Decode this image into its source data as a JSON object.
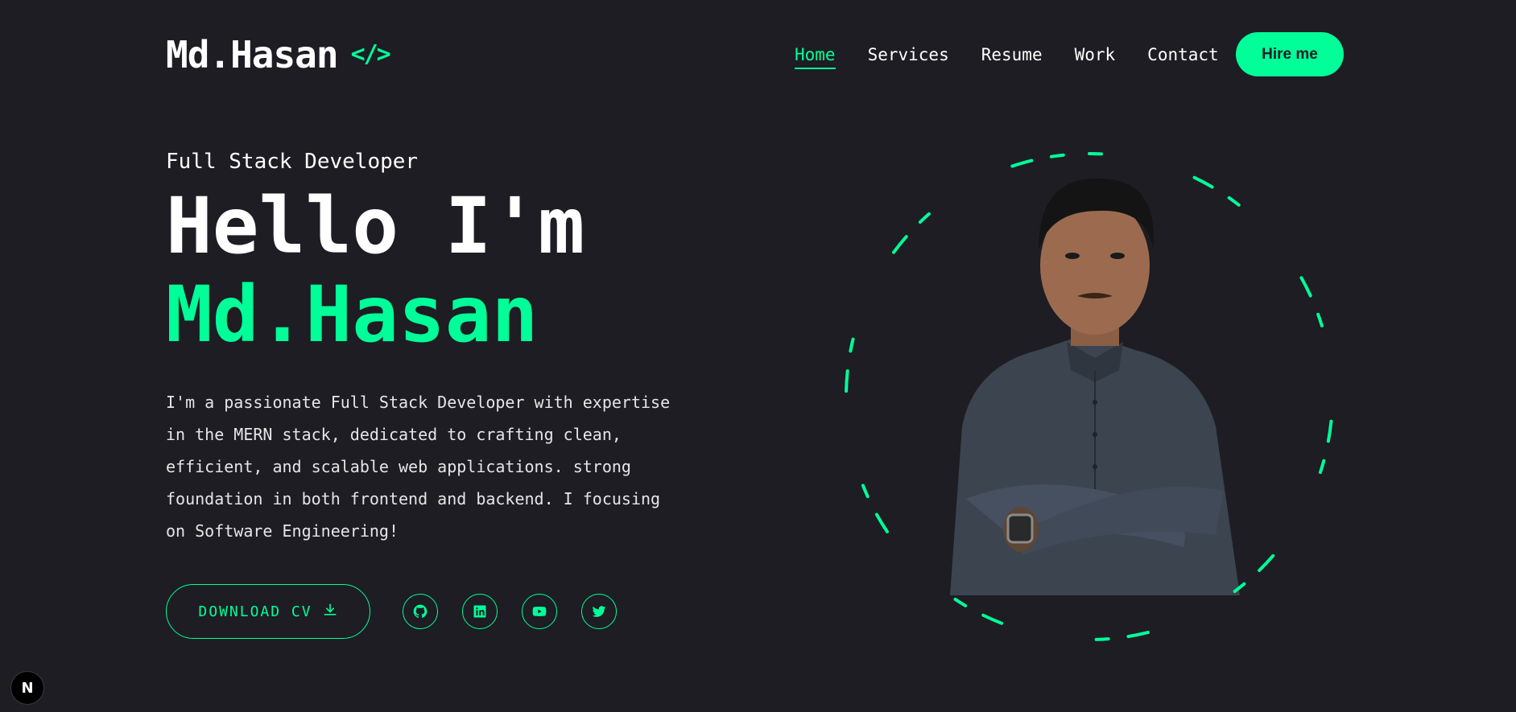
{
  "header": {
    "logo_text": "Md.Hasan",
    "logo_icon": "</>",
    "logo_icon_name": "code-brackets-icon",
    "nav": [
      {
        "label": "Home",
        "active": true
      },
      {
        "label": "Services",
        "active": false
      },
      {
        "label": "Resume",
        "active": false
      },
      {
        "label": "Work",
        "active": false
      },
      {
        "label": "Contact",
        "active": false
      }
    ],
    "hire_label": "Hire me"
  },
  "hero": {
    "subtitle": "Full Stack Developer",
    "greeting": "Hello I'm",
    "name": "Md.Hasan",
    "bio": "I'm a passionate Full Stack Developer with expertise in the MERN stack, dedicated to crafting clean, efficient, and scalable web applications. strong foundation in both frontend and backend. I focusing on Software Engineering!",
    "download_label": "DOWNLOAD CV",
    "download_icon": "download-icon",
    "socials": [
      {
        "name": "github-icon"
      },
      {
        "name": "linkedin-icon"
      },
      {
        "name": "youtube-icon"
      },
      {
        "name": "twitter-icon"
      }
    ]
  },
  "portrait": {
    "name": "profile-photo"
  },
  "dev_badge": {
    "label": "N"
  },
  "colors": {
    "background": "#1d1d23",
    "accent": "#00ff99",
    "text": "#ffffff"
  }
}
